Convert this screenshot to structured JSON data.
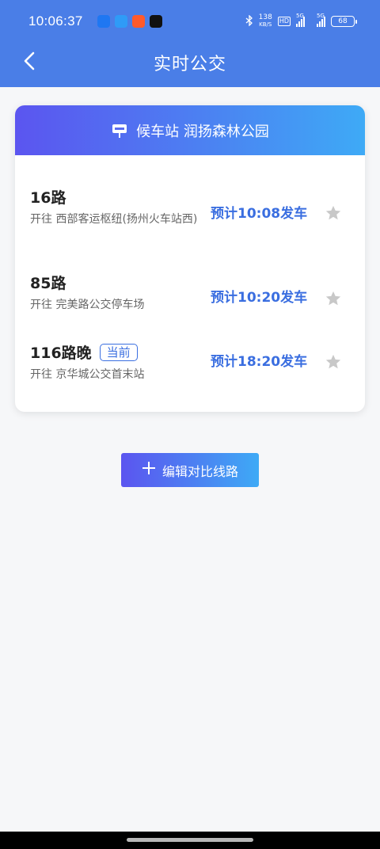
{
  "status_bar": {
    "time": "10:06:37",
    "net_speed_value": "138",
    "net_speed_unit": "KB/S",
    "hd_label": "HD",
    "signal_label_1": "5G",
    "signal_label_2": "5G",
    "battery": "68",
    "app_icons": [
      {
        "name": "app-icon-1",
        "color": "#1f77f2"
      },
      {
        "name": "app-icon-2",
        "color": "#2f9bf7"
      },
      {
        "name": "app-icon-3",
        "color": "#ff5a2c"
      },
      {
        "name": "app-icon-4",
        "color": "#111111"
      }
    ]
  },
  "nav": {
    "title": "实时公交",
    "back_icon": "chevron-left-icon"
  },
  "station": {
    "label": "候车站 润扬森林公园",
    "icon": "bus-stop-sign-icon"
  },
  "routes": [
    {
      "name": "16路",
      "destination": "开往 西部客运枢纽(扬州火车站西)",
      "eta": "预计10:08发车",
      "badge": ""
    },
    {
      "name": "85路",
      "destination": "开往 完美路公交停车场",
      "eta": "预计10:20发车",
      "badge": ""
    },
    {
      "name": "116路晚",
      "destination": "开往 京华城公交首末站",
      "eta": "预计18:20发车",
      "badge": "当前"
    }
  ],
  "actions": {
    "edit_label": "编辑对比线路",
    "edit_icon": "plus-icon"
  },
  "colors": {
    "header": "#4a7ee7",
    "accent_text": "#3a6ee0",
    "star": "#c8c8c8"
  }
}
